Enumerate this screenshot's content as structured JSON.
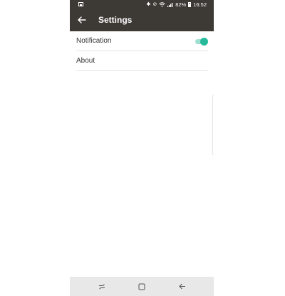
{
  "status_bar": {
    "icons": [
      "picture-icon",
      "bluetooth-icon",
      "mute-icon",
      "wifi-icon",
      "signal-icon",
      "battery-icon"
    ],
    "battery": "82%",
    "time": "16:52"
  },
  "app_bar": {
    "title": "Settings",
    "back_icon": "arrow-left-icon"
  },
  "settings": {
    "items": [
      {
        "label": "Notification",
        "toggle": true
      },
      {
        "label": "About"
      }
    ]
  },
  "theme": {
    "bar_color": "#3d3a36",
    "accent": "#26b99a"
  },
  "nav_bar": {
    "buttons": [
      "recents-icon",
      "home-icon",
      "back-icon"
    ]
  }
}
